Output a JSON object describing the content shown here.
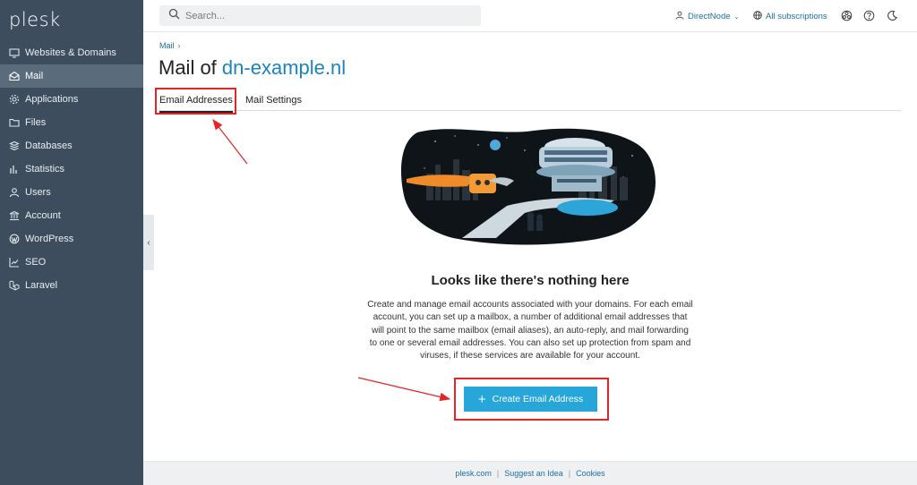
{
  "app": {
    "logo": "plesk"
  },
  "sidebar": {
    "items": [
      {
        "label": "Websites & Domains",
        "icon": "monitor-icon"
      },
      {
        "label": "Mail",
        "icon": "mail-icon",
        "active": true
      },
      {
        "label": "Applications",
        "icon": "gear-icon"
      },
      {
        "label": "Files",
        "icon": "folder-icon"
      },
      {
        "label": "Databases",
        "icon": "database-icon"
      },
      {
        "label": "Statistics",
        "icon": "bar-chart-icon"
      },
      {
        "label": "Users",
        "icon": "user-icon"
      },
      {
        "label": "Account",
        "icon": "bank-icon"
      },
      {
        "label": "WordPress",
        "icon": "wordpress-icon"
      },
      {
        "label": "SEO",
        "icon": "trend-icon"
      },
      {
        "label": "Laravel",
        "icon": "laravel-icon"
      }
    ],
    "collapse_glyph": "‹"
  },
  "header": {
    "search_placeholder": "Search...",
    "user_label": "DirectNode",
    "subscriptions_label": "All subscriptions"
  },
  "breadcrumb": {
    "item": "Mail",
    "separator": "›"
  },
  "page": {
    "title_prefix": "Mail of ",
    "title_domain": "dn-example.nl",
    "tabs": [
      "Email Addresses",
      "Mail Settings"
    ]
  },
  "empty_state": {
    "title": "Looks like there's nothing here",
    "description": "Create and manage email accounts associated with your domains. For each email account, you can set up a mailbox, a number of additional email addresses that will point to the same mailbox (email aliases), an auto-reply, and mail forwarding to one or several email addresses. You can also set up protection from spam and viruses, if these services are available for your account.",
    "button_label": "Create Email Address",
    "button_glyph": "+"
  },
  "footer": {
    "links": [
      "plesk.com",
      "Suggest an Idea",
      "Cookies"
    ],
    "separator": "|"
  },
  "colors": {
    "sidebar_bg": "#3d4d5e",
    "sidebar_active": "#5a6b7c",
    "accent": "#27a6d9",
    "link": "#1b6fa8",
    "annotation": "#e52525"
  }
}
